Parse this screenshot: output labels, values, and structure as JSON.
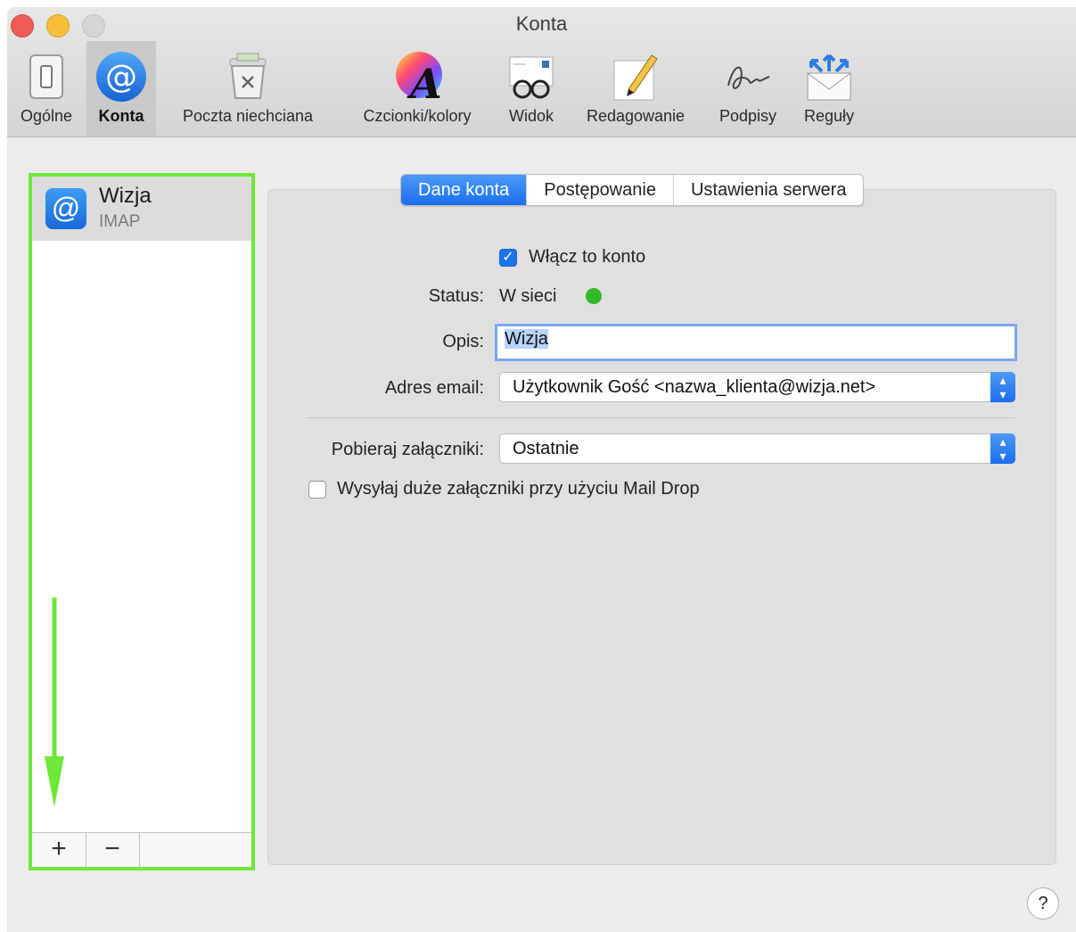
{
  "window": {
    "title": "Konta"
  },
  "toolbar": {
    "items": [
      {
        "label": "Ogólne",
        "icon": "general-switch-icon"
      },
      {
        "label": "Konta",
        "icon": "at-sign-icon"
      },
      {
        "label": "Poczta niechciana",
        "icon": "junk-bin-icon"
      },
      {
        "label": "Czcionki/kolory",
        "icon": "font-color-wheel-icon"
      },
      {
        "label": "Widok",
        "icon": "glasses-icon"
      },
      {
        "label": "Redagowanie",
        "icon": "pencil-paper-icon"
      },
      {
        "label": "Podpisy",
        "icon": "signature-icon"
      },
      {
        "label": "Reguły",
        "icon": "rules-envelope-icon"
      }
    ],
    "active_index": 1
  },
  "sidebar": {
    "accounts": [
      {
        "name": "Wizja",
        "type": "IMAP"
      }
    ],
    "add_label": "+",
    "remove_label": "−"
  },
  "tabs": {
    "items": [
      "Dane konta",
      "Postępowanie",
      "Ustawienia serwera"
    ],
    "selected": "Dane konta"
  },
  "form": {
    "enable_label": "Włącz to konto",
    "enable_checked": true,
    "status_label": "Status:",
    "status_value": "W sieci",
    "status_color": "#34b829",
    "description_label": "Opis:",
    "description_value": "Wizja",
    "email_label": "Adres email:",
    "email_value": "Użytkownik Gość <nazwa_klienta@wizja.net>",
    "attachments_label": "Pobieraj załączniki:",
    "attachments_value": "Ostatnie",
    "maildrop_label": "Wysyłaj duże załączniki przy użyciu Mail Drop",
    "maildrop_checked": false
  },
  "help": {
    "label": "?"
  },
  "colors": {
    "accent": "#1a6ef0",
    "highlight": "#6ee83a"
  }
}
